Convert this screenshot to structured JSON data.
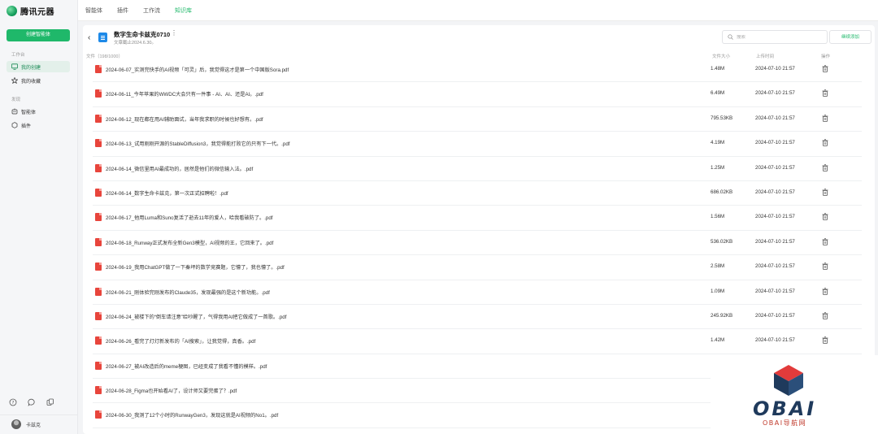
{
  "brand": {
    "name": "腾讯元器"
  },
  "sidebar": {
    "create_button": "创建智能体",
    "workspace_label": "工作台",
    "workspace_items": [
      {
        "label": "我的创建",
        "icon": "monitor-icon",
        "active": true
      },
      {
        "label": "我的收藏",
        "icon": "star-icon",
        "active": false
      }
    ],
    "discover_label": "发现",
    "discover_items": [
      {
        "label": "智能体",
        "icon": "robot-icon"
      },
      {
        "label": "插件",
        "icon": "plugin-icon"
      }
    ],
    "bottom_icons": [
      "help-icon",
      "chat-icon",
      "copy-icon"
    ],
    "user_name": "卡兹克"
  },
  "topnav": {
    "items": [
      {
        "label": "智能体",
        "active": false
      },
      {
        "label": "插件",
        "active": false
      },
      {
        "label": "工作流",
        "active": false
      },
      {
        "label": "知识库",
        "active": true
      }
    ]
  },
  "knowledge_base": {
    "title": "数字生命卡兹克0710",
    "subtitle": "文章截止2024.6.30。",
    "search_placeholder": "搜索",
    "continue_button": "继续添加",
    "columns": {
      "file": "文件（198/1000）",
      "size": "文件大小",
      "time": "上传时间",
      "action": "操作"
    }
  },
  "files": [
    {
      "name": "2024-06-07_实测完快手的AI视频「可灵」后，我觉得这才是第一个中国版Sora.pdf",
      "size": "1.48M",
      "time": "2024-07-10 21:57"
    },
    {
      "name": "2024-06-11_今年苹果的WWDC大会只有一件事 - AI、AI、还是AI。.pdf",
      "size": "6.49M",
      "time": "2024-07-10 21:57"
    },
    {
      "name": "2024-06-12_现在都在用AI辅助面试，当年我求职的时候也好想有。.pdf",
      "size": "795.53KB",
      "time": "2024-07-10 21:57"
    },
    {
      "name": "2024-06-13_试用刚刚开源的StableDiffusion3，我觉得能打败它的只有下一代。.pdf",
      "size": "4.19M",
      "time": "2024-07-10 21:57"
    },
    {
      "name": "2024-06-14_微信里用AI最成功的，居然是他们的微信输入法。.pdf",
      "size": "1.25M",
      "time": "2024-07-10 21:57"
    },
    {
      "name": "2024-06-14_数字生命卡兹克，第一次正式招聘啦！.pdf",
      "size": "686.02KB",
      "time": "2024-07-10 21:57"
    },
    {
      "name": "2024-06-17_他用Luma和Suno复活了逝去11年的爱人，哈我看破防了。.pdf",
      "size": "1.56M",
      "time": "2024-07-10 21:57"
    },
    {
      "name": "2024-06-18_Runway正式发布全新Gen3模型，AI视频的王，它回来了。.pdf",
      "size": "536.02KB",
      "time": "2024-07-10 21:57"
    },
    {
      "name": "2024-06-19_我用ChatGPT做了一下秦坪的数学竞赛题，它懵了，我也懵了。.pdf",
      "size": "2.58M",
      "time": "2024-07-10 21:57"
    },
    {
      "name": "2024-06-21_刚体验完刚发布的Claude35，发现最强的是这个新功能。.pdf",
      "size": "1.09M",
      "time": "2024-07-10 21:57"
    },
    {
      "name": "2024-06-24_被楼下的“倒车请注意”给吵醒了，气得我用AI把它做成了一首歌。.pdf",
      "size": "245.92KB",
      "time": "2024-07-10 21:57"
    },
    {
      "name": "2024-06-26_看完了灯灯新发布的「AI搜索」，让我觉得，真香。.pdf",
      "size": "1.42M",
      "time": "2024-07-10 21:57"
    },
    {
      "name": "2024-06-27_被AI改造后的meme梗图，已经变成了我看不懂的模样。.pdf",
      "size": "",
      "time": ""
    },
    {
      "name": "2024-06-28_Figma也开始看AI了，设计师又要完蛋了？.pdf",
      "size": "",
      "time": ""
    },
    {
      "name": "2024-06-30_我测了12个小时的RunwayGen3，发现这就是AI视频的No1。.pdf",
      "size": "",
      "time": ""
    }
  ],
  "watermark": {
    "logo_text": "OBAI",
    "sub_text": "OBAI导航网"
  },
  "colors": {
    "accent": "#1fb86a",
    "pdf": "#e8453c",
    "kb_icon": "#1e8ae8"
  }
}
